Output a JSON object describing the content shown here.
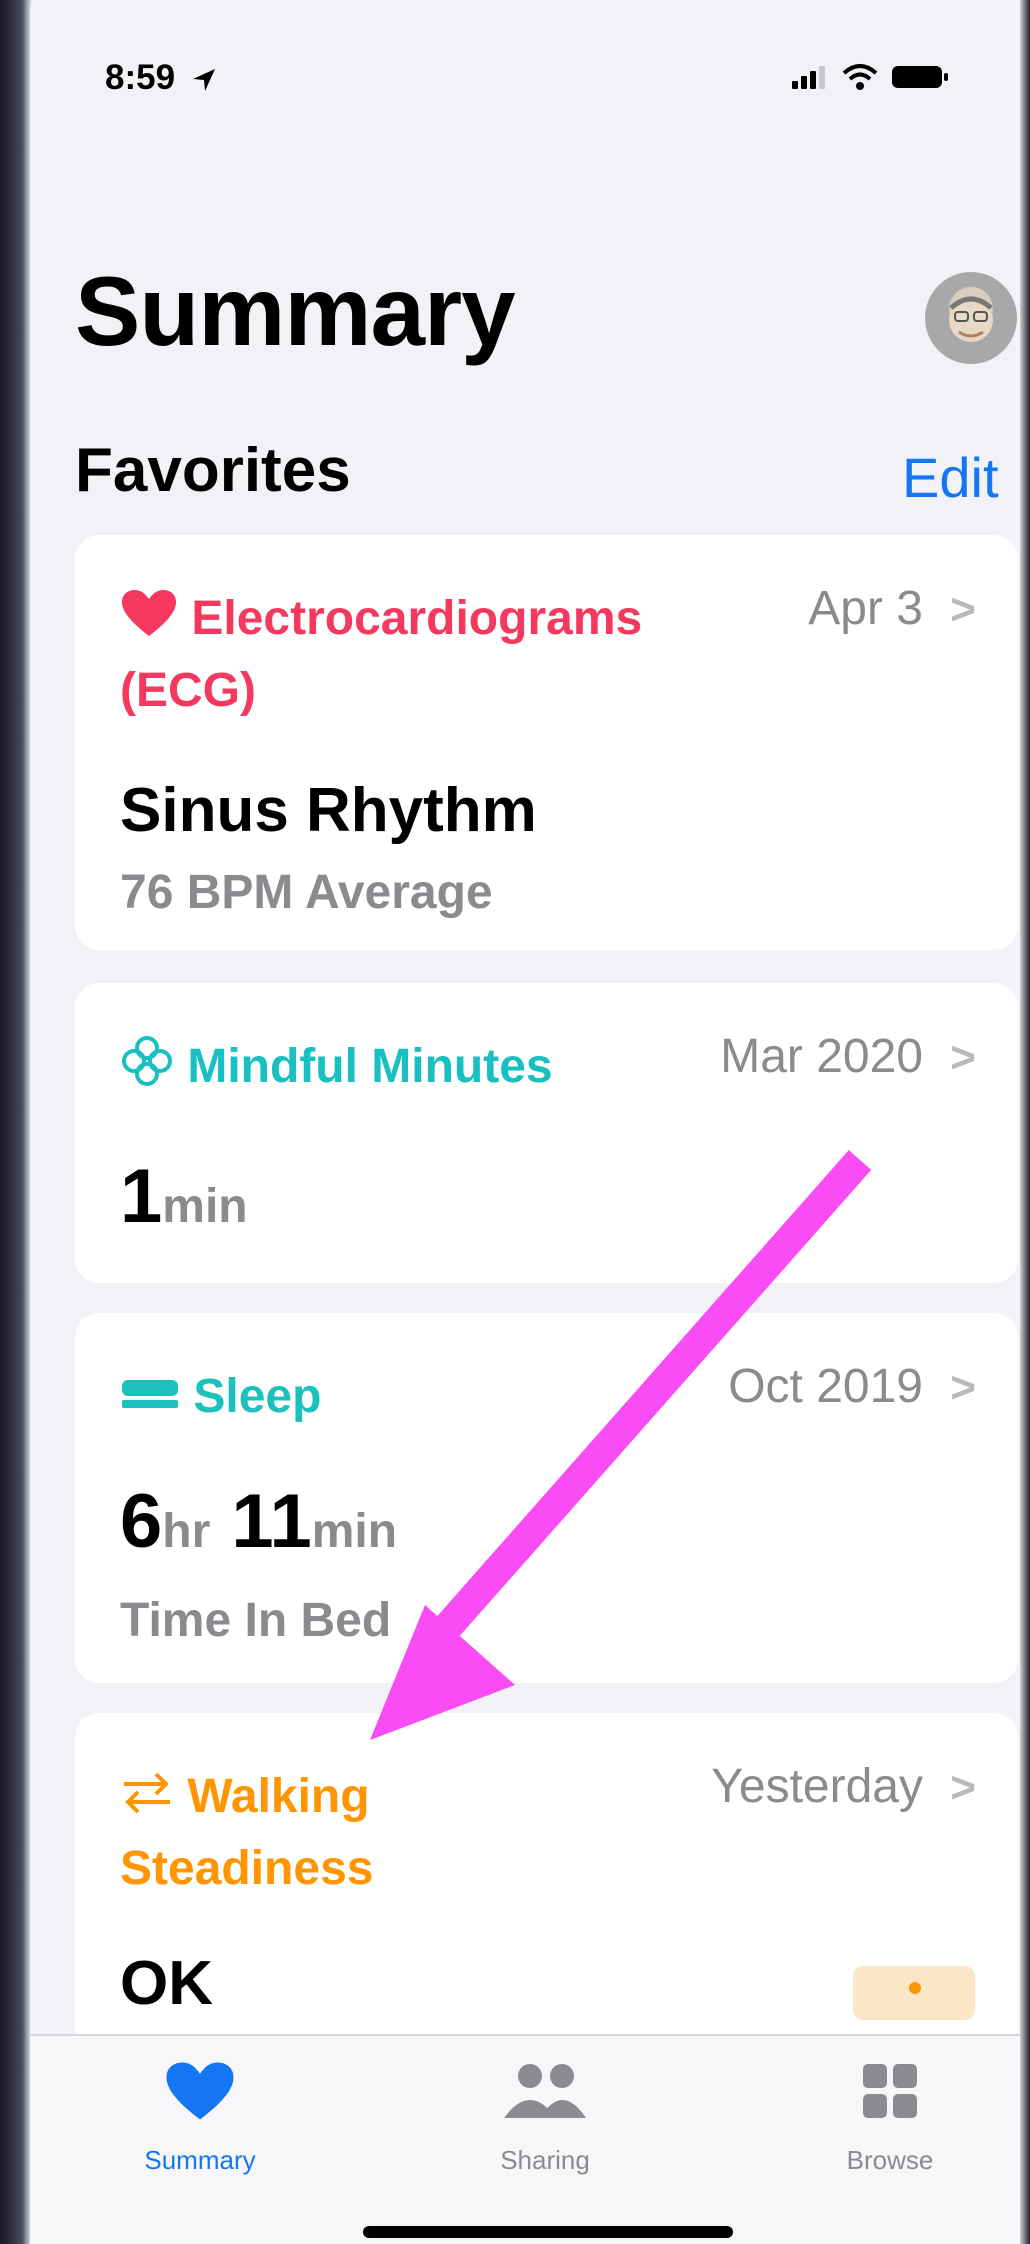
{
  "status_bar": {
    "time": "8:59"
  },
  "header": {
    "title": "Summary"
  },
  "favorites": {
    "title": "Favorites",
    "edit_label": "Edit"
  },
  "cards": [
    {
      "name": "Electrocardiograms (ECG)",
      "name_line1": "Electrocardiograms",
      "name_line2": "(ECG)",
      "date": "Apr 3",
      "value": "Sinus Rhythm",
      "subtext": "76 BPM Average",
      "color": "#f5385d",
      "icon": "heart-icon"
    },
    {
      "name": "Mindful Minutes",
      "date": "Mar 2020",
      "value": "1",
      "unit": "min",
      "color": "#18c0c2",
      "icon": "mindfulness-flower-icon"
    },
    {
      "name": "Sleep",
      "date": "Oct 2019",
      "value_hours": "6",
      "unit_hours": "hr",
      "value_minutes": "11",
      "unit_minutes": "min",
      "subtext": "Time In Bed",
      "color": "#1bc1ba",
      "icon": "bed-icon"
    },
    {
      "name": "Walking Steadiness",
      "name_line1": "Walking",
      "name_line2": "Steadiness",
      "date": "Yesterday",
      "value": "OK",
      "color": "#ff9500",
      "icon": "steadiness-arrows-icon"
    }
  ],
  "tabs": [
    {
      "label": "Summary",
      "icon": "heart-icon",
      "active": true
    },
    {
      "label": "Sharing",
      "icon": "people-icon",
      "active": false
    },
    {
      "label": "Browse",
      "icon": "grid-icon",
      "active": false
    }
  ],
  "colors": {
    "accent": "#1476f2",
    "annotation_arrow": "#f94cf4"
  }
}
